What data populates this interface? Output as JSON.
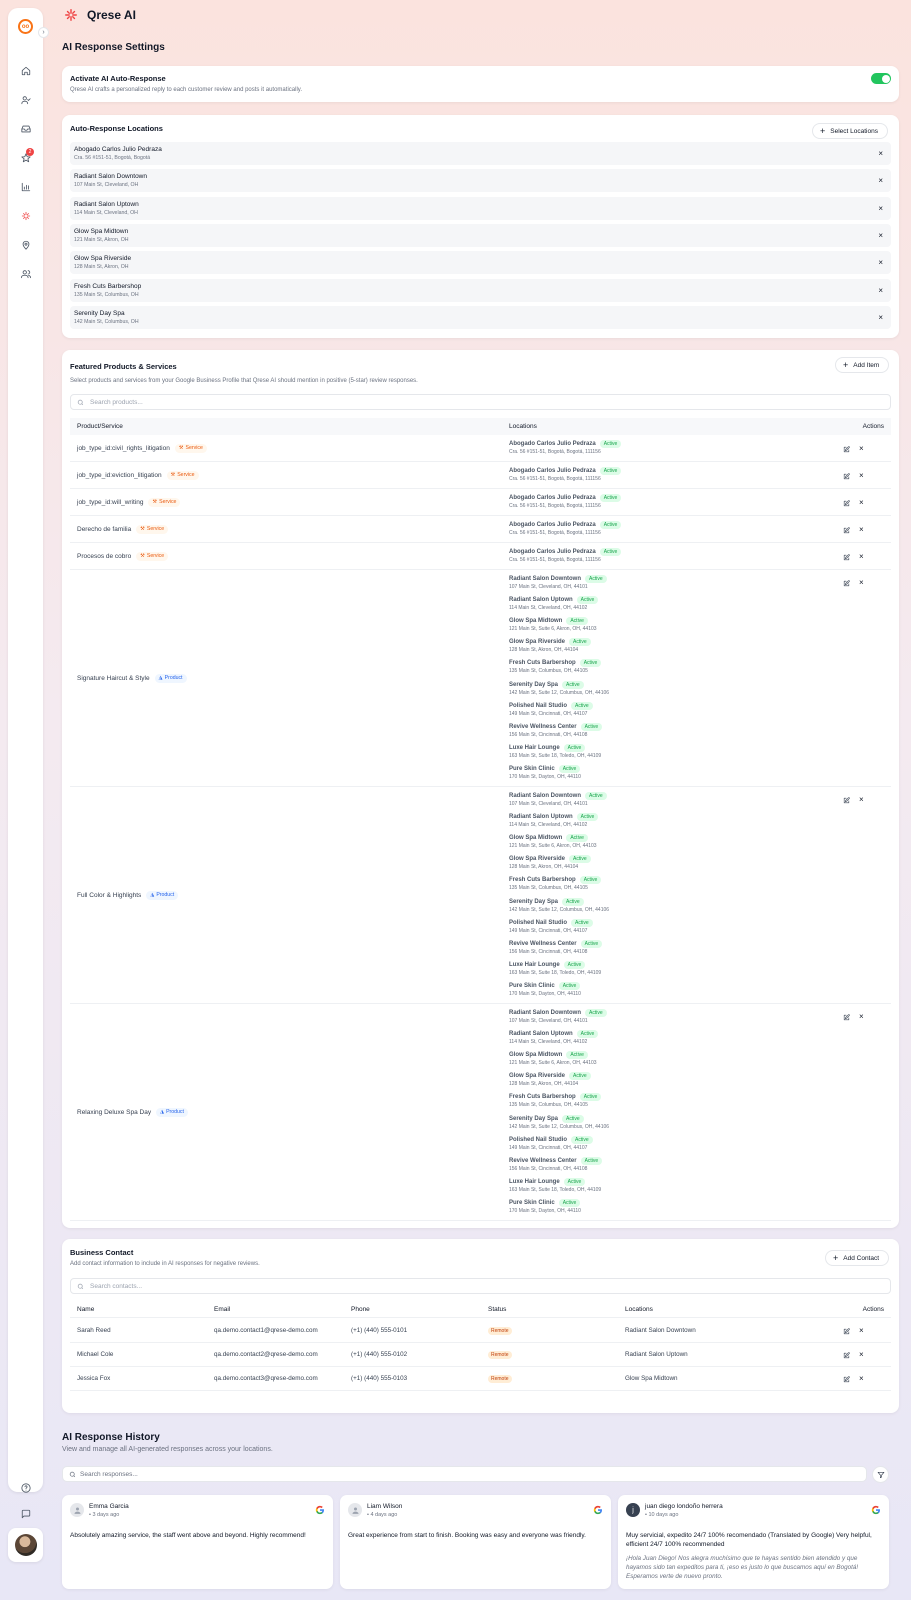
{
  "app": {
    "name": "Qrese AI",
    "logo_text": "Qrese"
  },
  "sidebar": {
    "badge_count": "2"
  },
  "page_title": "AI Response Settings",
  "auto_response": {
    "title": "Activate AI Auto-Response",
    "description": "Qrese AI crafts a personalized reply to each customer review and posts it automatically.",
    "enabled": true
  },
  "locations": {
    "title": "Auto-Response Locations",
    "select_label": "Select Locations",
    "items": [
      {
        "name": "Abogado Carlos Julio Pedraza",
        "address": "Cra. 56 #151-51, Bogotá, Bogotá"
      },
      {
        "name": "Radiant Salon Downtown",
        "address": "107 Main St, Cleveland, OH"
      },
      {
        "name": "Radiant Salon Uptown",
        "address": "114 Main St, Cleveland, OH"
      },
      {
        "name": "Glow Spa Midtown",
        "address": "121 Main St, Akron, OH"
      },
      {
        "name": "Glow Spa Riverside",
        "address": "128 Main St, Akron, OH"
      },
      {
        "name": "Fresh Cuts Barbershop",
        "address": "135 Main St, Columbus, OH"
      },
      {
        "name": "Serenity Day Spa",
        "address": "142 Main St, Columbus, OH"
      }
    ]
  },
  "products": {
    "title": "Featured Products & Services",
    "description": "Select products and services from your Google Business Profile that Qrese AI should mention in positive (5-star) review responses.",
    "add_label": "Add Item",
    "search_placeholder": "Search products...",
    "columns": {
      "name": "Product/Service",
      "locations": "Locations",
      "actions": "Actions"
    },
    "active_label": "Active",
    "rows": [
      {
        "name": "job_type_id:civil_rights_litigation",
        "type": "Service",
        "locations": [
          {
            "name": "Abogado Carlos Julio Pedraza",
            "address": "Cra. 56 #151-51, Bogotá, Bogotá, 111156"
          }
        ]
      },
      {
        "name": "job_type_id:eviction_litigation",
        "type": "Service",
        "locations": [
          {
            "name": "Abogado Carlos Julio Pedraza",
            "address": "Cra. 56 #151-51, Bogotá, Bogotá, 111156"
          }
        ]
      },
      {
        "name": "job_type_id:will_writing",
        "type": "Service",
        "locations": [
          {
            "name": "Abogado Carlos Julio Pedraza",
            "address": "Cra. 56 #151-51, Bogotá, Bogotá, 111156"
          }
        ]
      },
      {
        "name": "Derecho de familia",
        "type": "Service",
        "locations": [
          {
            "name": "Abogado Carlos Julio Pedraza",
            "address": "Cra. 56 #151-51, Bogotá, Bogotá, 111156"
          }
        ]
      },
      {
        "name": "Procesos de cobro",
        "type": "Service",
        "locations": [
          {
            "name": "Abogado Carlos Julio Pedraza",
            "address": "Cra. 56 #151-51, Bogotá, Bogotá, 111156"
          }
        ]
      },
      {
        "name": "Signature Haircut & Style",
        "type": "Product",
        "locations": [
          {
            "name": "Radiant Salon Downtown",
            "address": "107 Main St, Cleveland, OH, 44101"
          },
          {
            "name": "Radiant Salon Uptown",
            "address": "114 Main St, Cleveland, OH, 44102"
          },
          {
            "name": "Glow Spa Midtown",
            "address": "121 Main St, Suite 6, Akron, OH, 44103"
          },
          {
            "name": "Glow Spa Riverside",
            "address": "128 Main St, Akron, OH, 44104"
          },
          {
            "name": "Fresh Cuts Barbershop",
            "address": "135 Main St, Columbus, OH, 44105"
          },
          {
            "name": "Serenity Day Spa",
            "address": "142 Main St, Suite 12, Columbus, OH, 44106"
          },
          {
            "name": "Polished Nail Studio",
            "address": "149 Main St, Cincinnati, OH, 44107"
          },
          {
            "name": "Revive Wellness Center",
            "address": "156 Main St, Cincinnati, OH, 44108"
          },
          {
            "name": "Luxe Hair Lounge",
            "address": "163 Main St, Suite 18, Toledo, OH, 44109"
          },
          {
            "name": "Pure Skin Clinic",
            "address": "170 Main St, Dayton, OH, 44110"
          }
        ]
      },
      {
        "name": "Full Color & Highlights",
        "type": "Product",
        "locations": [
          {
            "name": "Radiant Salon Downtown",
            "address": "107 Main St, Cleveland, OH, 44101"
          },
          {
            "name": "Radiant Salon Uptown",
            "address": "114 Main St, Cleveland, OH, 44102"
          },
          {
            "name": "Glow Spa Midtown",
            "address": "121 Main St, Suite 6, Akron, OH, 44103"
          },
          {
            "name": "Glow Spa Riverside",
            "address": "128 Main St, Akron, OH, 44104"
          },
          {
            "name": "Fresh Cuts Barbershop",
            "address": "135 Main St, Columbus, OH, 44105"
          },
          {
            "name": "Serenity Day Spa",
            "address": "142 Main St, Suite 12, Columbus, OH, 44106"
          },
          {
            "name": "Polished Nail Studio",
            "address": "149 Main St, Cincinnati, OH, 44107"
          },
          {
            "name": "Revive Wellness Center",
            "address": "156 Main St, Cincinnati, OH, 44108"
          },
          {
            "name": "Luxe Hair Lounge",
            "address": "163 Main St, Suite 18, Toledo, OH, 44109"
          },
          {
            "name": "Pure Skin Clinic",
            "address": "170 Main St, Dayton, OH, 44110"
          }
        ]
      },
      {
        "name": "Relaxing Deluxe Spa Day",
        "type": "Product",
        "locations": [
          {
            "name": "Radiant Salon Downtown",
            "address": "107 Main St, Cleveland, OH, 44101"
          },
          {
            "name": "Radiant Salon Uptown",
            "address": "114 Main St, Cleveland, OH, 44102"
          },
          {
            "name": "Glow Spa Midtown",
            "address": "121 Main St, Suite 6, Akron, OH, 44103"
          },
          {
            "name": "Glow Spa Riverside",
            "address": "128 Main St, Akron, OH, 44104"
          },
          {
            "name": "Fresh Cuts Barbershop",
            "address": "135 Main St, Columbus, OH, 44105"
          },
          {
            "name": "Serenity Day Spa",
            "address": "142 Main St, Suite 12, Columbus, OH, 44106"
          },
          {
            "name": "Polished Nail Studio",
            "address": "149 Main St, Cincinnati, OH, 44107"
          },
          {
            "name": "Revive Wellness Center",
            "address": "156 Main St, Cincinnati, OH, 44108"
          },
          {
            "name": "Luxe Hair Lounge",
            "address": "163 Main St, Suite 18, Toledo, OH, 44109"
          },
          {
            "name": "Pure Skin Clinic",
            "address": "170 Main St, Dayton, OH, 44110"
          }
        ]
      }
    ]
  },
  "contacts": {
    "title": "Business Contact",
    "description": "Add contact information to include in AI responses for negative reviews.",
    "add_label": "Add Contact",
    "search_placeholder": "Search contacts...",
    "columns": {
      "name": "Name",
      "email": "Email",
      "phone": "Phone",
      "status": "Status",
      "locations": "Locations",
      "actions": "Actions"
    },
    "rows": [
      {
        "name": "Sarah Reed",
        "email": "qa.demo.contact1@qrese-demo.com",
        "phone": "(+1) (440) 555-0101",
        "status": "Remote",
        "location": "Radiant Salon Downtown"
      },
      {
        "name": "Michael Cole",
        "email": "qa.demo.contact2@qrese-demo.com",
        "phone": "(+1) (440) 555-0102",
        "status": "Remote",
        "location": "Radiant Salon Uptown"
      },
      {
        "name": "Jessica Fox",
        "email": "qa.demo.contact3@qrese-demo.com",
        "phone": "(+1) (440) 555-0103",
        "status": "Remote",
        "location": "Glow Spa Midtown"
      }
    ]
  },
  "history": {
    "title": "AI Response History",
    "description": "View and manage all AI-generated responses across your locations.",
    "search_placeholder": "Search responses...",
    "reviews": [
      {
        "name": "Emma Garcia",
        "time": "• 3 days ago",
        "text": "Absolutely amazing service, the staff went above and beyond. Highly recommend!",
        "reply": "",
        "initial": ""
      },
      {
        "name": "Liam Wilson",
        "time": "• 4 days ago",
        "text": "Great experience from start to finish. Booking was easy and everyone was friendly.",
        "reply": "",
        "initial": ""
      },
      {
        "name": "juan diego londoño herrera",
        "time": "• 10 days ago",
        "text": "Muy servicial, expedito 24/7 100% recomendado (Translated by Google) Very helpful, efficient 24/7 100% recommended",
        "reply": "¡Hola Juan Diego! Nos alegra muchísimo que te hayas sentido bien atendido y que hayamos sido tan expeditos para ti, ¡eso es justo lo que buscamos aquí en Bogotá! Esperamos verte de nuevo pronto.",
        "initial": "j"
      }
    ]
  },
  "colors": {
    "accent": "#ef4444",
    "toggle_on": "#22c55e",
    "active_badge": "#16a34a",
    "service_tag": "#ea580c",
    "product_tag": "#2563eb"
  }
}
